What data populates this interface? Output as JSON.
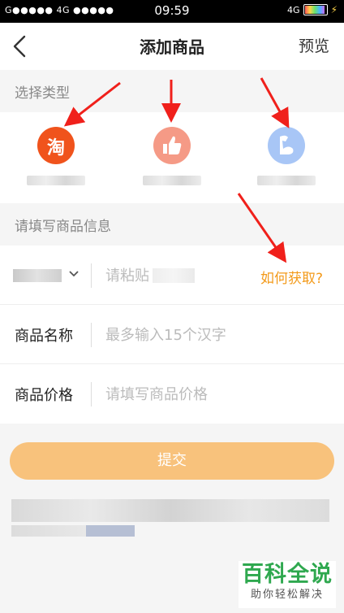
{
  "status_bar": {
    "carrier_left": "G●●●●● 4G ●●●●●",
    "time": "09:59",
    "signal_right": "4G"
  },
  "navbar": {
    "title": "添加商品",
    "preview": "预览"
  },
  "type_section": {
    "heading": "选择类型",
    "items": [
      {
        "icon": "taobao-icon",
        "glyph": "淘",
        "color": "#f0531c"
      },
      {
        "icon": "thumbs-up-icon",
        "color": "#f59a86"
      },
      {
        "icon": "flex-arm-icon",
        "color": "#a8c6f6"
      }
    ]
  },
  "info_section": {
    "heading": "请填写商品信息"
  },
  "form": {
    "link_row": {
      "placeholder": "请粘贴",
      "help_link": "如何获取?"
    },
    "name_row": {
      "label": "商品名称",
      "placeholder": "最多输入15个汉字"
    },
    "price_row": {
      "label": "商品价格",
      "placeholder": "请填写商品价格"
    }
  },
  "submit": {
    "label": "提交",
    "color": "#f8c27c"
  },
  "watermark": {
    "title": "百科全说",
    "subtitle": "助你轻松解决"
  }
}
